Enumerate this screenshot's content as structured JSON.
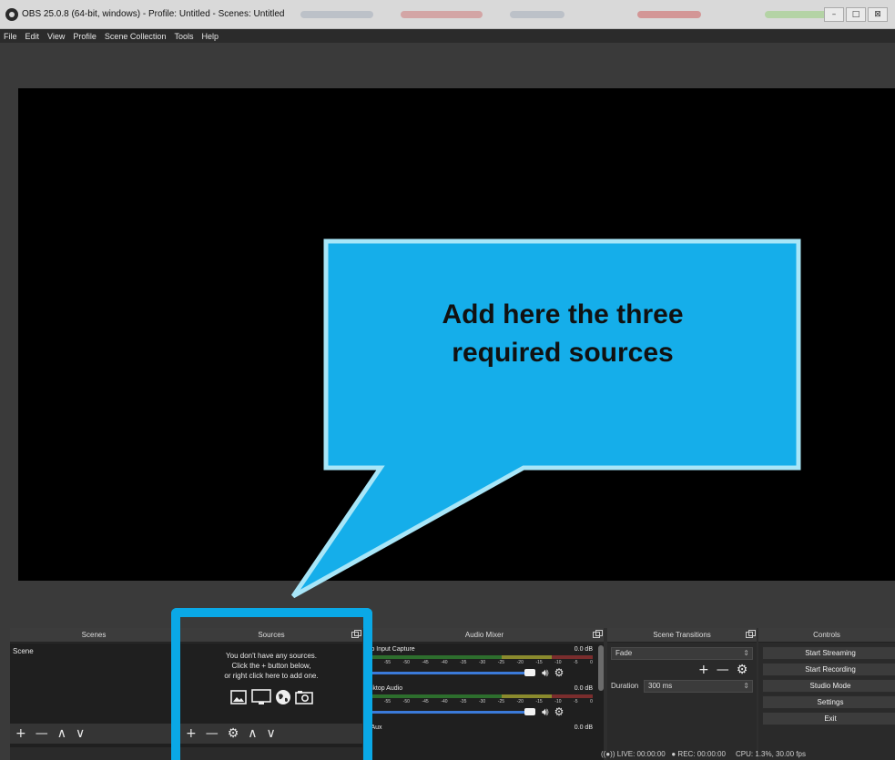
{
  "window": {
    "title": "OBS 25.0.8 (64-bit, windows) - Profile: Untitled - Scenes: Untitled",
    "controls": {
      "minimize": "–",
      "maximize": "□",
      "close": "⊠"
    }
  },
  "menu": [
    "File",
    "Edit",
    "View",
    "Profile",
    "Scene Collection",
    "Tools",
    "Help"
  ],
  "docks": {
    "scenes": {
      "title": "Scenes",
      "items": [
        "Scene"
      ],
      "toolbar": [
        "+",
        "—",
        "∧",
        "∨"
      ]
    },
    "sources": {
      "title": "Sources",
      "empty_line1": "You don't have any sources.",
      "empty_line2": "Click the + button below,",
      "empty_line3": "or right click here to add one.",
      "toolbar": [
        "+",
        "—",
        "⚙",
        "∧",
        "∨"
      ]
    },
    "audio_mixer": {
      "title": "Audio Mixer",
      "channels": [
        {
          "name": "dio Input Capture",
          "db": "0.0 dB"
        },
        {
          "name": "esktop Audio",
          "db": "0.0 dB"
        },
        {
          "name": "c/Aux",
          "db": "0.0 dB"
        }
      ],
      "ticks": [
        "-60",
        "-55",
        "-50",
        "-45",
        "-40",
        "-35",
        "-30",
        "-25",
        "-20",
        "-15",
        "-10",
        "-5",
        "0"
      ],
      "volume_level": 0.92
    },
    "transitions": {
      "title": "Scene Transitions",
      "selected": "Fade",
      "duration_label": "Duration",
      "duration_value": "300 ms"
    },
    "controls": {
      "title": "Controls",
      "buttons": [
        "Start Streaming",
        "Start Recording",
        "Studio Mode",
        "Settings",
        "Exit"
      ]
    }
  },
  "status": {
    "live": "LIVE: 00:00:00",
    "rec": "REC: 00:00:00",
    "cpu": "CPU: 1.3%, 30.00 fps"
  },
  "callout": {
    "line1": "Add here the three",
    "line2": "required sources"
  },
  "colors": {
    "callout_fill": "#15aeea",
    "callout_border": "#a8e6f8",
    "highlight": "#0aa8e6"
  }
}
